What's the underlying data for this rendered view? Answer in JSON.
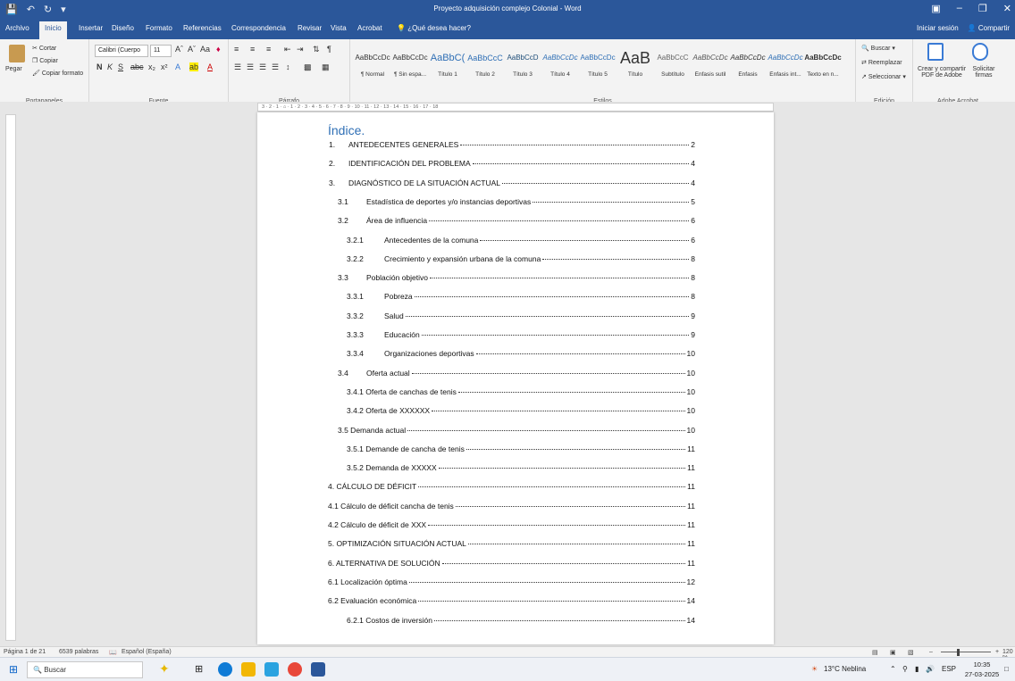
{
  "titlebar": {
    "doc_title": "Proyecto adquisición complejo Colonial - Word"
  },
  "tabs": [
    {
      "label": "Archivo"
    },
    {
      "label": "Inicio"
    },
    {
      "label": "Insertar"
    },
    {
      "label": "Diseño"
    },
    {
      "label": "Formato"
    },
    {
      "label": "Referencias"
    },
    {
      "label": "Correspondencia"
    },
    {
      "label": "Revisar"
    },
    {
      "label": "Vista"
    },
    {
      "label": "Acrobat"
    }
  ],
  "tellme": "¿Qué desea hacer?",
  "signin": "Iniciar sesión",
  "share": "Compartir",
  "ribbon": {
    "clipboard": {
      "paste": "Pegar",
      "cut": "Cortar",
      "copy": "Copiar",
      "format": "Copiar formato",
      "label": "Portapapeles"
    },
    "font": {
      "name": "Calibri (Cuerpo",
      "size": "11",
      "label": "Fuente"
    },
    "paragraph": {
      "label": "Párrafo"
    },
    "styles": {
      "label": "Estilos",
      "items": [
        {
          "preview": "AaBbCcDc",
          "name": "¶ Normal"
        },
        {
          "preview": "AaBbCcDc",
          "name": "¶ Sin espa..."
        },
        {
          "preview": "AaBbC(",
          "name": "Título 1"
        },
        {
          "preview": "AaBbCcC",
          "name": "Título 2"
        },
        {
          "preview": "AaBbCcD",
          "name": "Título 3"
        },
        {
          "preview": "AaBbCcDc",
          "name": "Título 4"
        },
        {
          "preview": "AaBbCcDc",
          "name": "Título 5"
        },
        {
          "preview": "AaB",
          "name": "Título"
        },
        {
          "preview": "AaBbCcC",
          "name": "Subtítulo"
        },
        {
          "preview": "AaBbCcDc",
          "name": "Énfasis sutil"
        },
        {
          "preview": "AaBbCcDc",
          "name": "Énfasis"
        },
        {
          "preview": "AaBbCcDc",
          "name": "Énfasis int..."
        },
        {
          "preview": "AaBbCcDc",
          "name": "Texto en n..."
        }
      ]
    },
    "editing": {
      "find": "Buscar",
      "replace": "Reemplazar",
      "select": "Seleccionar",
      "label": "Edición"
    },
    "acrobat": {
      "create": "Crear y compartir",
      "create2": "PDF de Adobe",
      "sign": "Solicitar",
      "sign2": "firmas",
      "label": "Adobe Acrobat"
    }
  },
  "document": {
    "toc_title": "Índice.",
    "entries": [
      {
        "num": "1.",
        "text": "ANTEDECENTES GENERALES",
        "page": "2"
      },
      {
        "num": "2.",
        "text": "IDENTIFICACIÓN DEL PROBLEMA",
        "page": "4"
      },
      {
        "num": "3.",
        "text": "DIAGNÓSTICO DE LA SITUACIÓN ACTUAL",
        "page": "4"
      },
      {
        "num": "3.1",
        "text": "Estadística de deportes y/o instancias deportivas",
        "page": "5"
      },
      {
        "num": "3.2",
        "text": "Área de influencia",
        "page": "6"
      },
      {
        "num": "3.2.1",
        "text": "Antecedentes de la comuna",
        "page": "6"
      },
      {
        "num": "3.2.2",
        "text": "Crecimiento y expansión urbana de la comuna",
        "page": "8"
      },
      {
        "num": "3.3",
        "text": "Población objetivo",
        "page": "8"
      },
      {
        "num": "3.3.1",
        "text": "Pobreza",
        "page": "8"
      },
      {
        "num": "3.3.2",
        "text": "Salud",
        "page": "9"
      },
      {
        "num": "3.3.3",
        "text": "Educación",
        "page": "9"
      },
      {
        "num": "3.3.4",
        "text": "Organizaciones deportivas",
        "page": "10"
      },
      {
        "num": "3.4",
        "text": "Oferta actual",
        "page": "10"
      },
      {
        "num": "",
        "text": "3.4.1 Oferta de canchas de tenis",
        "page": "10"
      },
      {
        "num": "",
        "text": "3.4.2 Oferta de XXXXXX",
        "page": "10"
      },
      {
        "num": "",
        "text": "3.5 Demanda actual",
        "page": "10"
      },
      {
        "num": "",
        "text": "3.5.1 Demande de cancha de tenis",
        "page": "11"
      },
      {
        "num": "",
        "text": "3.5.2 Demanda de XXXXX",
        "page": "11"
      },
      {
        "num": "",
        "text": "4. CÁLCULO DE DÉFICIT",
        "page": "11"
      },
      {
        "num": "",
        "text": "4.1 Cálculo de déficit cancha de tenis",
        "page": "11"
      },
      {
        "num": "",
        "text": "4.2 Cálculo de déficit de XXX",
        "page": "11"
      },
      {
        "num": "",
        "text": "5. OPTIMIZACIÓN SITUACIÓN ACTUAL",
        "page": "11"
      },
      {
        "num": "",
        "text": "6. ALTERNATIVA DE SOLUCIÓN",
        "page": "11"
      },
      {
        "num": "",
        "text": "6.1 Localización óptima",
        "page": "12"
      },
      {
        "num": "",
        "text": "6.2 Evaluación económica",
        "page": "14"
      },
      {
        "num": "",
        "text": "6.2.1 Costos de inversión",
        "page": "14"
      }
    ]
  },
  "status": {
    "page": "Página 1 de 21",
    "words": "6539 palabras",
    "lang": "Español (España)",
    "zoom": "120 %"
  },
  "taskbar": {
    "search": "Buscar",
    "weather": "13°C Neblina",
    "lang": "ESP",
    "time": "10:35",
    "date": "27-03-2025"
  },
  "colors": {
    "accent": "#2b579a",
    "heading": "#2f6fb5"
  }
}
